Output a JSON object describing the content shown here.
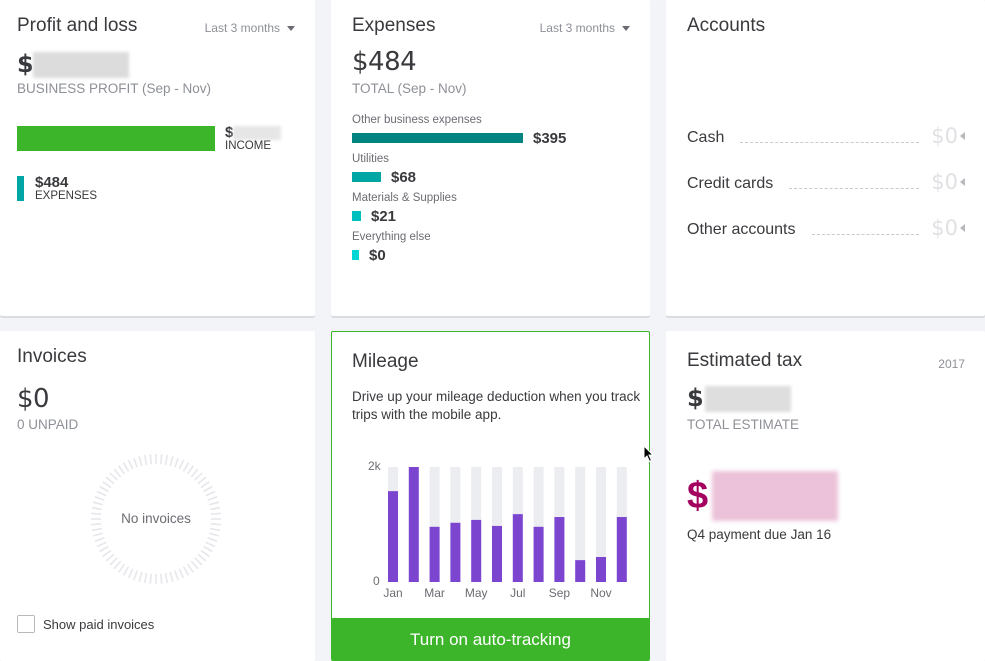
{
  "profit_loss": {
    "title": "Profit and loss",
    "period": "Last 3 months",
    "amount_prefix": "$",
    "subtitle": "BUSINESS PROFIT (Sep - Nov)",
    "income": {
      "value_prefix": "$",
      "label": "INCOME"
    },
    "expenses": {
      "value": "$484",
      "label": "EXPENSES"
    }
  },
  "expenses": {
    "title": "Expenses",
    "period": "Last 3 months",
    "total": "$484",
    "subtitle": "TOTAL (Sep - Nov)",
    "categories": [
      {
        "name": "Other business expenses",
        "amount": "$395",
        "value": 395,
        "color": "#008481"
      },
      {
        "name": "Utilities",
        "amount": "$68",
        "value": 68,
        "color": "#00a6a4"
      },
      {
        "name": "Materials & Supplies",
        "amount": "$21",
        "value": 21,
        "color": "#00c1bf"
      },
      {
        "name": "Everything else",
        "amount": "$0",
        "value": 0,
        "color": "#00d7d4"
      }
    ]
  },
  "accounts": {
    "title": "Accounts",
    "items": [
      {
        "name": "Cash",
        "amount": "$0"
      },
      {
        "name": "Credit cards",
        "amount": "$0"
      },
      {
        "name": "Other accounts",
        "amount": "$0"
      }
    ]
  },
  "invoices": {
    "title": "Invoices",
    "amount": "$0",
    "subtitle": "0 UNPAID",
    "empty_text": "No invoices",
    "show_paid_label": "Show paid invoices",
    "show_paid_checked": false
  },
  "mileage": {
    "title": "Mileage",
    "description": "Drive up your mileage deduction when you track trips with the mobile app.",
    "button_label": "Turn on auto-tracking",
    "chart_data": {
      "type": "bar",
      "categories": [
        "Jan",
        "Feb",
        "Mar",
        "Apr",
        "May",
        "Jun",
        "Jul",
        "Aug",
        "Sep",
        "Oct",
        "Nov",
        "Dec"
      ],
      "values": [
        1580,
        2000,
        960,
        1030,
        1080,
        975,
        1180,
        960,
        1130,
        380,
        435,
        1130
      ],
      "x_tick_labels": [
        "Jan",
        "Mar",
        "May",
        "Jul",
        "Sep",
        "Nov"
      ],
      "y_tick_labels": [
        "0",
        "2k"
      ],
      "ylim": [
        0,
        2000
      ],
      "bar_color": "#7c45d0",
      "track_color": "#ecedf0",
      "title": "",
      "xlabel": "",
      "ylabel": ""
    }
  },
  "estimated_tax": {
    "title": "Estimated tax",
    "year": "2017",
    "amount_prefix": "$",
    "subtitle": "TOTAL ESTIMATE",
    "payment_prefix": "$",
    "payment_due": "Q4 payment due Jan 16"
  }
}
